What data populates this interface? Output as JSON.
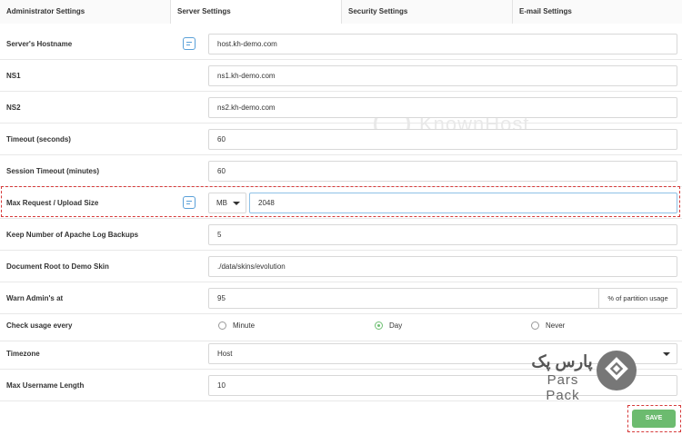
{
  "tabs": [
    {
      "label": "Administrator Settings"
    },
    {
      "label": "Server Settings"
    },
    {
      "label": "Security Settings"
    },
    {
      "label": "E-mail Settings"
    }
  ],
  "fields": {
    "hostname": {
      "label": "Server's Hostname",
      "value": "host.kh-demo.com"
    },
    "ns1": {
      "label": "NS1",
      "value": "ns1.kh-demo.com"
    },
    "ns2": {
      "label": "NS2",
      "value": "ns2.kh-demo.com"
    },
    "timeout": {
      "label": "Timeout (seconds)",
      "value": "60"
    },
    "session_timeout": {
      "label": "Session Timeout (minutes)",
      "value": "60"
    },
    "max_request": {
      "label": "Max Request / Upload Size",
      "unit": "MB",
      "value": "2048"
    },
    "log_backups": {
      "label": "Keep Number of Apache Log Backups",
      "value": "5"
    },
    "doc_root": {
      "label": "Document Root to Demo Skin",
      "value": "./data/skins/evolution"
    },
    "warn_admin": {
      "label": "Warn Admin's at",
      "value": "95",
      "suffix": "% of partition usage"
    },
    "check_usage": {
      "label": "Check usage every",
      "options": [
        {
          "label": "Minute",
          "checked": false
        },
        {
          "label": "Day",
          "checked": true
        },
        {
          "label": "Never",
          "checked": false
        }
      ]
    },
    "timezone": {
      "label": "Timezone",
      "value": "Host"
    },
    "max_username": {
      "label": "Max Username Length",
      "value": "10"
    }
  },
  "save_label": "SAVE",
  "watermark": {
    "text": "KnownHost"
  },
  "brand": {
    "name_fa": "پارس پک",
    "name_en": "Pars Pack"
  },
  "colors": {
    "accent_green": "#6cbb6f",
    "highlight_red": "#d63a3a",
    "focus_blue": "#8ec1e6",
    "icon_blue": "#5aa0d8"
  },
  "icons": [
    "edit-icon",
    "chevron-down-icon"
  ]
}
